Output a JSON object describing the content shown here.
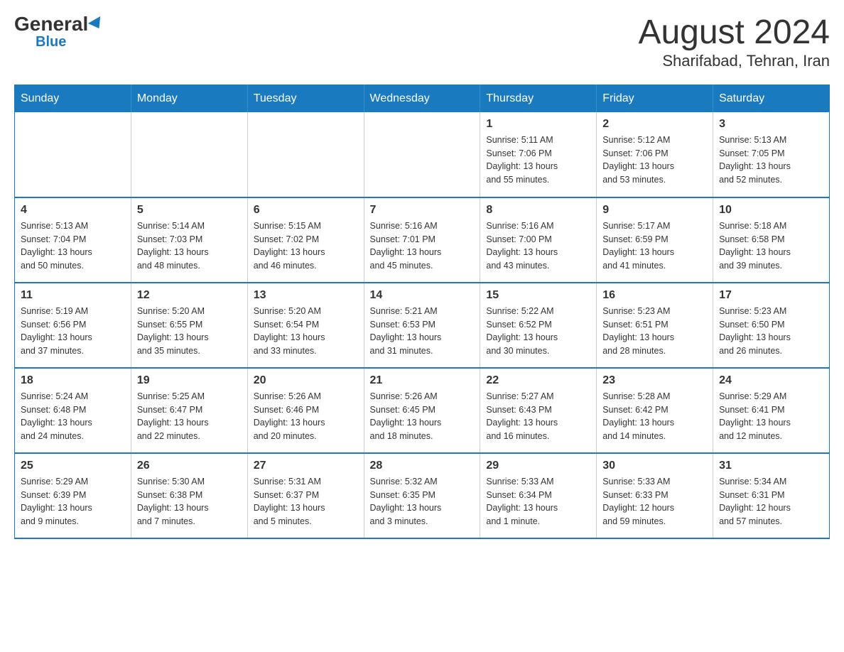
{
  "header": {
    "logo_general": "General",
    "logo_blue": "Blue",
    "month_title": "August 2024",
    "location": "Sharifabad, Tehran, Iran"
  },
  "days_of_week": [
    "Sunday",
    "Monday",
    "Tuesday",
    "Wednesday",
    "Thursday",
    "Friday",
    "Saturday"
  ],
  "weeks": [
    [
      {
        "day": "",
        "info": ""
      },
      {
        "day": "",
        "info": ""
      },
      {
        "day": "",
        "info": ""
      },
      {
        "day": "",
        "info": ""
      },
      {
        "day": "1",
        "info": "Sunrise: 5:11 AM\nSunset: 7:06 PM\nDaylight: 13 hours\nand 55 minutes."
      },
      {
        "day": "2",
        "info": "Sunrise: 5:12 AM\nSunset: 7:06 PM\nDaylight: 13 hours\nand 53 minutes."
      },
      {
        "day": "3",
        "info": "Sunrise: 5:13 AM\nSunset: 7:05 PM\nDaylight: 13 hours\nand 52 minutes."
      }
    ],
    [
      {
        "day": "4",
        "info": "Sunrise: 5:13 AM\nSunset: 7:04 PM\nDaylight: 13 hours\nand 50 minutes."
      },
      {
        "day": "5",
        "info": "Sunrise: 5:14 AM\nSunset: 7:03 PM\nDaylight: 13 hours\nand 48 minutes."
      },
      {
        "day": "6",
        "info": "Sunrise: 5:15 AM\nSunset: 7:02 PM\nDaylight: 13 hours\nand 46 minutes."
      },
      {
        "day": "7",
        "info": "Sunrise: 5:16 AM\nSunset: 7:01 PM\nDaylight: 13 hours\nand 45 minutes."
      },
      {
        "day": "8",
        "info": "Sunrise: 5:16 AM\nSunset: 7:00 PM\nDaylight: 13 hours\nand 43 minutes."
      },
      {
        "day": "9",
        "info": "Sunrise: 5:17 AM\nSunset: 6:59 PM\nDaylight: 13 hours\nand 41 minutes."
      },
      {
        "day": "10",
        "info": "Sunrise: 5:18 AM\nSunset: 6:58 PM\nDaylight: 13 hours\nand 39 minutes."
      }
    ],
    [
      {
        "day": "11",
        "info": "Sunrise: 5:19 AM\nSunset: 6:56 PM\nDaylight: 13 hours\nand 37 minutes."
      },
      {
        "day": "12",
        "info": "Sunrise: 5:20 AM\nSunset: 6:55 PM\nDaylight: 13 hours\nand 35 minutes."
      },
      {
        "day": "13",
        "info": "Sunrise: 5:20 AM\nSunset: 6:54 PM\nDaylight: 13 hours\nand 33 minutes."
      },
      {
        "day": "14",
        "info": "Sunrise: 5:21 AM\nSunset: 6:53 PM\nDaylight: 13 hours\nand 31 minutes."
      },
      {
        "day": "15",
        "info": "Sunrise: 5:22 AM\nSunset: 6:52 PM\nDaylight: 13 hours\nand 30 minutes."
      },
      {
        "day": "16",
        "info": "Sunrise: 5:23 AM\nSunset: 6:51 PM\nDaylight: 13 hours\nand 28 minutes."
      },
      {
        "day": "17",
        "info": "Sunrise: 5:23 AM\nSunset: 6:50 PM\nDaylight: 13 hours\nand 26 minutes."
      }
    ],
    [
      {
        "day": "18",
        "info": "Sunrise: 5:24 AM\nSunset: 6:48 PM\nDaylight: 13 hours\nand 24 minutes."
      },
      {
        "day": "19",
        "info": "Sunrise: 5:25 AM\nSunset: 6:47 PM\nDaylight: 13 hours\nand 22 minutes."
      },
      {
        "day": "20",
        "info": "Sunrise: 5:26 AM\nSunset: 6:46 PM\nDaylight: 13 hours\nand 20 minutes."
      },
      {
        "day": "21",
        "info": "Sunrise: 5:26 AM\nSunset: 6:45 PM\nDaylight: 13 hours\nand 18 minutes."
      },
      {
        "day": "22",
        "info": "Sunrise: 5:27 AM\nSunset: 6:43 PM\nDaylight: 13 hours\nand 16 minutes."
      },
      {
        "day": "23",
        "info": "Sunrise: 5:28 AM\nSunset: 6:42 PM\nDaylight: 13 hours\nand 14 minutes."
      },
      {
        "day": "24",
        "info": "Sunrise: 5:29 AM\nSunset: 6:41 PM\nDaylight: 13 hours\nand 12 minutes."
      }
    ],
    [
      {
        "day": "25",
        "info": "Sunrise: 5:29 AM\nSunset: 6:39 PM\nDaylight: 13 hours\nand 9 minutes."
      },
      {
        "day": "26",
        "info": "Sunrise: 5:30 AM\nSunset: 6:38 PM\nDaylight: 13 hours\nand 7 minutes."
      },
      {
        "day": "27",
        "info": "Sunrise: 5:31 AM\nSunset: 6:37 PM\nDaylight: 13 hours\nand 5 minutes."
      },
      {
        "day": "28",
        "info": "Sunrise: 5:32 AM\nSunset: 6:35 PM\nDaylight: 13 hours\nand 3 minutes."
      },
      {
        "day": "29",
        "info": "Sunrise: 5:33 AM\nSunset: 6:34 PM\nDaylight: 13 hours\nand 1 minute."
      },
      {
        "day": "30",
        "info": "Sunrise: 5:33 AM\nSunset: 6:33 PM\nDaylight: 12 hours\nand 59 minutes."
      },
      {
        "day": "31",
        "info": "Sunrise: 5:34 AM\nSunset: 6:31 PM\nDaylight: 12 hours\nand 57 minutes."
      }
    ]
  ]
}
